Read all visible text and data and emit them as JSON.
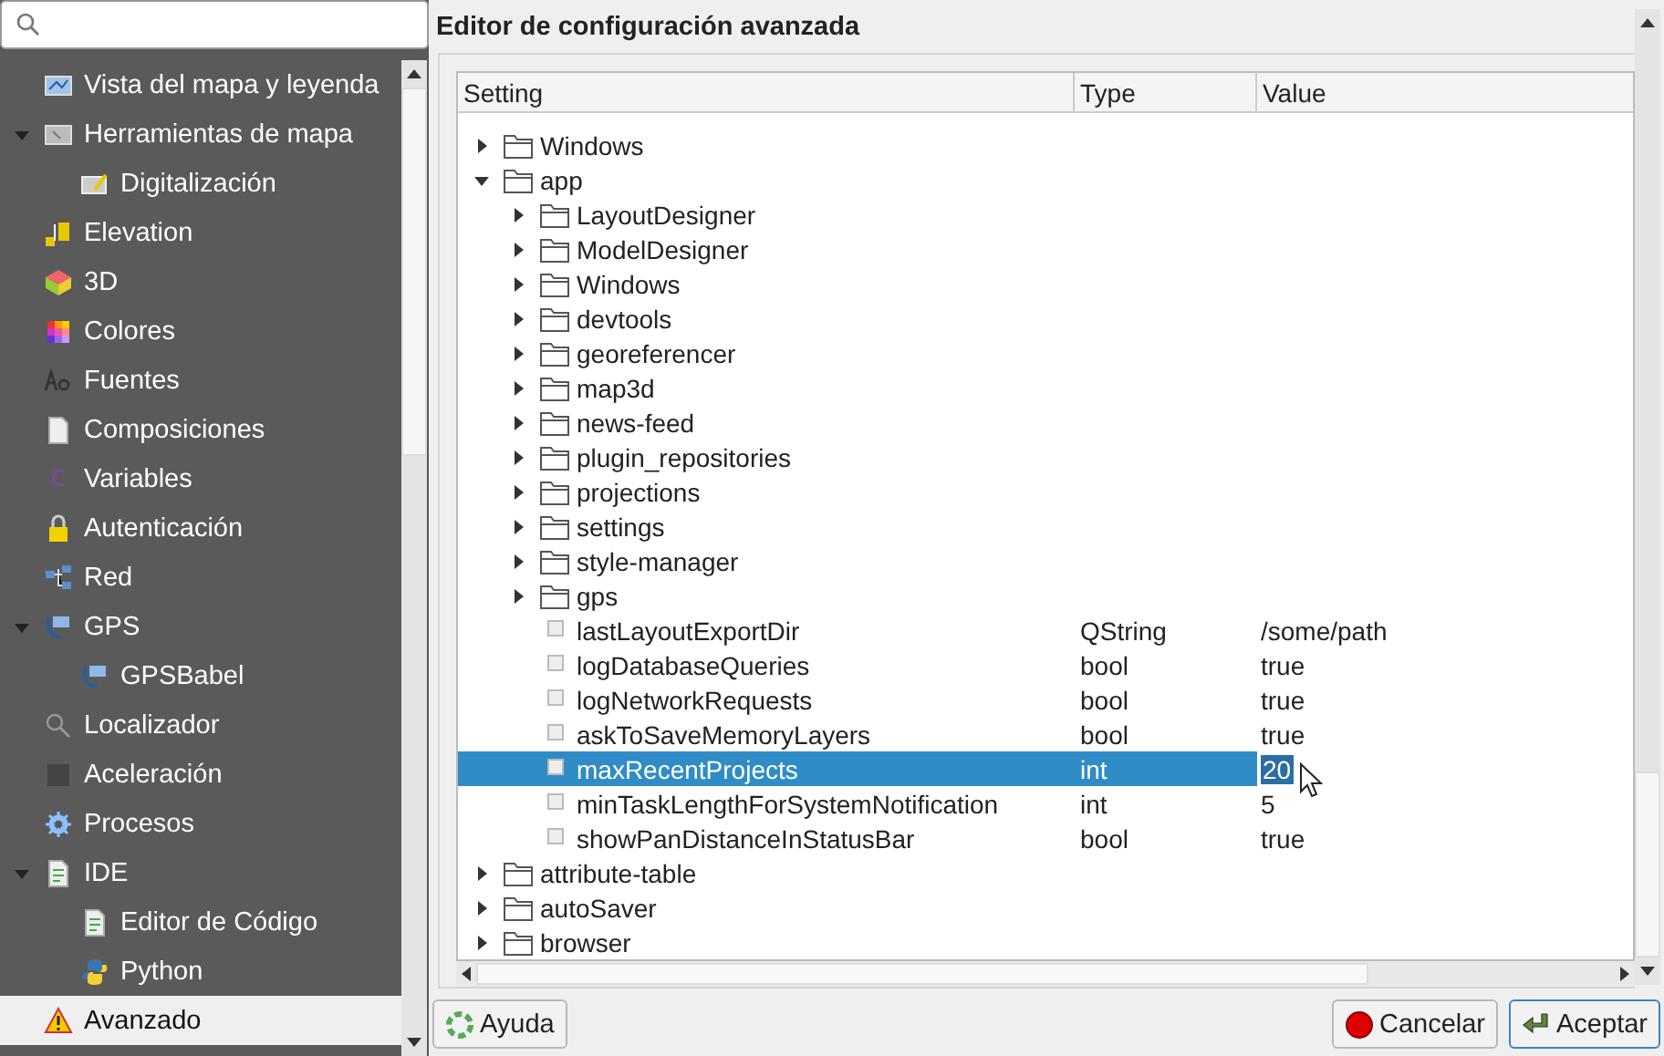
{
  "sidebar": {
    "items": [
      {
        "label": "Vista del mapa y leyenda",
        "selected": false
      },
      {
        "label": "Herramientas de mapa",
        "selected": false,
        "expanded": true,
        "children": [
          {
            "label": "Digitalización",
            "selected": false
          }
        ]
      },
      {
        "label": "Elevation",
        "selected": false
      },
      {
        "label": "3D",
        "selected": false
      },
      {
        "label": "Colores",
        "selected": false
      },
      {
        "label": "Fuentes",
        "selected": false
      },
      {
        "label": "Composiciones",
        "selected": false
      },
      {
        "label": "Variables",
        "selected": false
      },
      {
        "label": "Autenticación",
        "selected": false
      },
      {
        "label": "Red",
        "selected": false
      },
      {
        "label": "GPS",
        "selected": false,
        "expanded": true,
        "children": [
          {
            "label": "GPSBabel",
            "selected": false
          }
        ]
      },
      {
        "label": "Localizador",
        "selected": false
      },
      {
        "label": "Aceleración",
        "selected": false
      },
      {
        "label": "Procesos",
        "selected": false
      },
      {
        "label": "IDE",
        "selected": false,
        "expanded": true,
        "children": [
          {
            "label": "Editor de Código",
            "selected": false
          },
          {
            "label": "Python",
            "selected": false
          }
        ]
      },
      {
        "label": "Avanzado",
        "selected": true
      }
    ]
  },
  "panel": {
    "title": "Editor de configuración avanzada",
    "tree": {
      "columns": [
        "Setting",
        "Type",
        "Value"
      ],
      "rows": [
        {
          "kind": "group",
          "name": "Windows",
          "expanded": false,
          "selected": false
        },
        {
          "kind": "group",
          "name": "app",
          "expanded": true,
          "selected": false,
          "children": [
            {
              "kind": "group",
              "name": "LayoutDesigner",
              "expanded": false,
              "selected": false
            },
            {
              "kind": "group",
              "name": "ModelDesigner",
              "expanded": false,
              "selected": false
            },
            {
              "kind": "group",
              "name": "Windows",
              "expanded": false,
              "selected": false
            },
            {
              "kind": "group",
              "name": "devtools",
              "expanded": false,
              "selected": false
            },
            {
              "kind": "group",
              "name": "georeferencer",
              "expanded": false,
              "selected": false
            },
            {
              "kind": "group",
              "name": "map3d",
              "expanded": false,
              "selected": false
            },
            {
              "kind": "group",
              "name": "news-feed",
              "expanded": false,
              "selected": false
            },
            {
              "kind": "group",
              "name": "plugin_repositories",
              "expanded": false,
              "selected": false
            },
            {
              "kind": "group",
              "name": "projections",
              "expanded": false,
              "selected": false
            },
            {
              "kind": "group",
              "name": "settings",
              "expanded": false,
              "selected": false
            },
            {
              "kind": "group",
              "name": "style-manager",
              "expanded": false,
              "selected": false
            },
            {
              "kind": "group",
              "name": "gps",
              "expanded": false,
              "selected": false
            },
            {
              "kind": "setting",
              "name": "lastLayoutExportDir",
              "type": "QString",
              "value": "/some/path",
              "selected": false
            },
            {
              "kind": "setting",
              "name": "logDatabaseQueries",
              "type": "bool",
              "value": "true",
              "selected": false
            },
            {
              "kind": "setting",
              "name": "logNetworkRequests",
              "type": "bool",
              "value": "true",
              "selected": false
            },
            {
              "kind": "setting",
              "name": "askToSaveMemoryLayers",
              "type": "bool",
              "value": "true",
              "selected": false
            },
            {
              "kind": "setting",
              "name": "maxRecentProjects",
              "type": "int",
              "value": "20",
              "selected": true
            },
            {
              "kind": "setting",
              "name": "minTaskLengthForSystemNotification",
              "type": "int",
              "value": "5",
              "selected": false
            },
            {
              "kind": "setting",
              "name": "showPanDistanceInStatusBar",
              "type": "bool",
              "value": "true",
              "selected": false
            }
          ]
        },
        {
          "kind": "group",
          "name": "attribute-table",
          "expanded": false,
          "selected": false
        },
        {
          "kind": "group",
          "name": "autoSaver",
          "expanded": false,
          "selected": false
        },
        {
          "kind": "group",
          "name": "browser",
          "expanded": false,
          "selected": false
        }
      ]
    }
  },
  "buttons": [
    {
      "kind": "help",
      "label": "Ayuda"
    },
    {
      "kind": "cancel",
      "label": "Cancelar"
    },
    {
      "kind": "ok",
      "label": "Aceptar"
    }
  ]
}
